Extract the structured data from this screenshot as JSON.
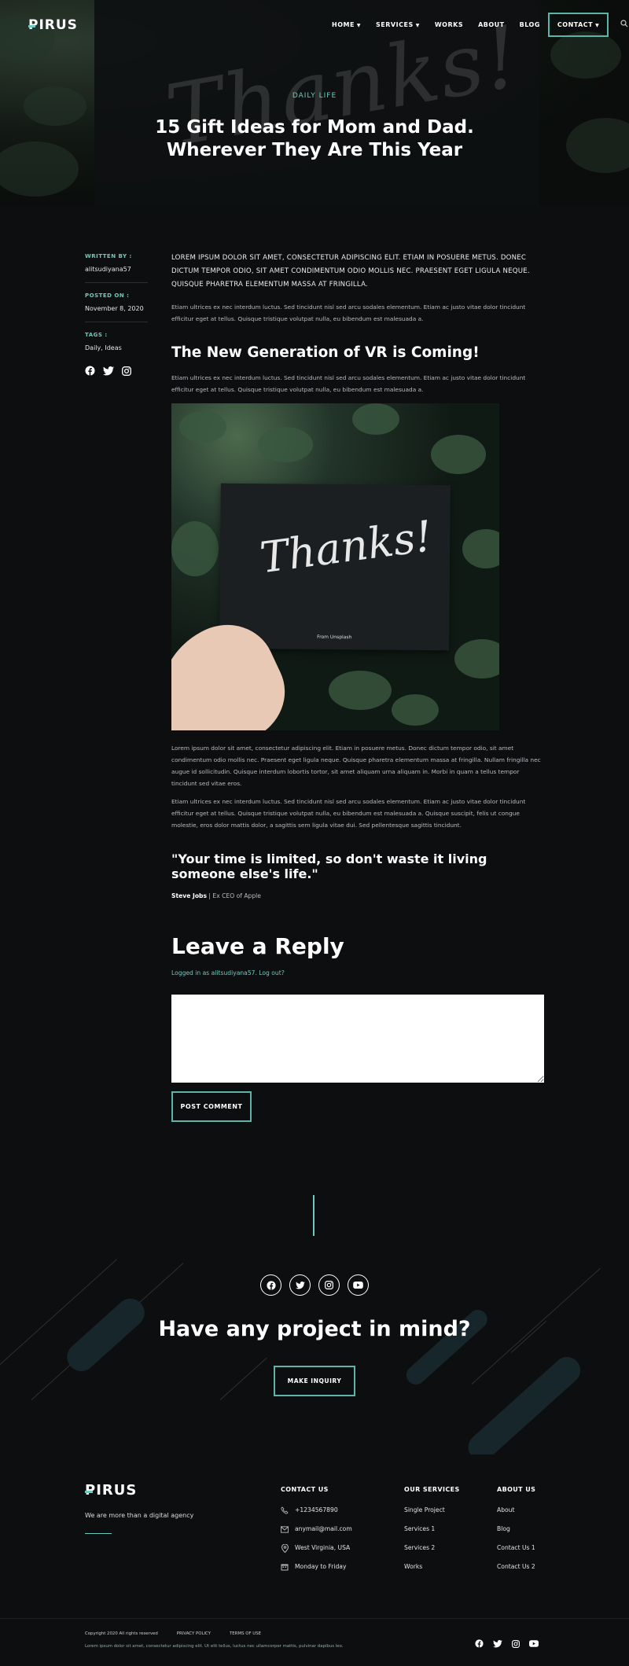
{
  "brand": {
    "logo": "PIRUS",
    "accent": "#6fc9bd"
  },
  "nav": {
    "items": [
      {
        "label": "HOME",
        "has_dropdown": true
      },
      {
        "label": "SERVICES",
        "has_dropdown": true
      },
      {
        "label": "WORKS",
        "has_dropdown": false
      },
      {
        "label": "ABOUT",
        "has_dropdown": false
      },
      {
        "label": "BLOG",
        "has_dropdown": false
      }
    ],
    "contact_label": "CONTACT",
    "search_icon": "search-icon"
  },
  "hero": {
    "background_text": "Thanks!",
    "category": "DAILY LIFE",
    "title": "15 Gift Ideas for Mom and Dad. Wherever They Are This Year"
  },
  "meta": {
    "written_by_label": "WRITTEN BY :",
    "author": "alitsudiyana57",
    "posted_on_label": "POSTED ON :",
    "date": "November 8, 2020",
    "tags_label": "TAGS :",
    "tags": "Daily, Ideas",
    "social_icons": [
      "facebook-icon",
      "twitter-icon",
      "instagram-icon"
    ]
  },
  "article": {
    "lead": "LOREM IPSUM DOLOR SIT AMET, CONSECTETUR ADIPISCING ELIT. ETIAM IN POSUERE METUS. DONEC DICTUM TEMPOR ODIO, SIT AMET CONDIMENTUM ODIO MOLLIS NEC. PRAESENT EGET LIGULA NEQUE. QUISQUE PHARETRA ELEMENTUM MASSA AT FRINGILLA.",
    "p1": "Etiam ultrices ex nec interdum luctus. Sed tincidunt nisl sed arcu sodales elementum. Etiam ac justo vitae dolor tincidunt efficitur eget at tellus. Quisque tristique volutpat nulla, eu bibendum est malesuada a.",
    "heading": "The New Generation of VR is Coming!",
    "p2": "Etiam ultrices ex nec interdum luctus. Sed tincidunt nisl sed arcu sodales elementum. Etiam ac justo vitae dolor tincidunt efficitur eget at tellus. Quisque tristique volutpat nulla, eu bibendum est malesuada a.",
    "image_card_text": "Thanks!",
    "image_card_caption": "From Unsplash",
    "p3": "Lorem ipsum dolor sit amet, consectetur adipiscing elit. Etiam in posuere metus. Donec dictum tempor odio, sit amet condimentum odio mollis nec. Praesent eget ligula neque. Quisque pharetra elementum massa at fringilla. Nullam fringilla nec augue id sollicitudin. Quisque interdum lobortis tortor, sit amet aliquam urna aliquam in. Morbi in quam a tellus tempor tincidunt sed vitae eros.",
    "p4": "Etiam ultrices ex nec interdum luctus. Sed tincidunt nisl sed arcu sodales elementum. Etiam ac justo vitae dolor tincidunt efficitur eget at tellus. Quisque tristique volutpat nulla, eu bibendum est malesuada a. Quisque suscipit, felis ut congue molestie, eros dolor mattis dolor, a sagittis sem ligula vitae dui. Sed pellentesque sagittis tincidunt.",
    "quote": "\"Your time is limited, so don't waste it living someone else's life.\"",
    "quote_author": "Steve Jobs",
    "quote_role": "| Ex CEO of Apple"
  },
  "reply": {
    "heading": "Leave a Reply",
    "logged_in": "Logged in as alitsudiyana57. Log out?",
    "comment_value": "",
    "post_label": "POST COMMENT"
  },
  "cta": {
    "social_icons": [
      "facebook-icon",
      "twitter-icon",
      "instagram-icon",
      "youtube-icon"
    ],
    "heading": "Have any project in mind?",
    "button": "MAKE INQUIRY"
  },
  "footer": {
    "tagline": "We are more than a digital agency",
    "contact": {
      "heading": "CONTACT US",
      "items": [
        {
          "icon": "phone-icon",
          "text": "+1234567890"
        },
        {
          "icon": "mail-icon",
          "text": "anymail@mail.com"
        },
        {
          "icon": "location-icon",
          "text": "West Virginia, USA"
        },
        {
          "icon": "calendar-icon",
          "text": "Monday to Friday"
        }
      ]
    },
    "services": {
      "heading": "OUR SERVICES",
      "items": [
        "Single Project",
        "Services 1",
        "Services 2",
        "Works"
      ]
    },
    "about": {
      "heading": "ABOUT US",
      "items": [
        "About",
        "Blog",
        "Contact Us 1",
        "Contact Us 2"
      ]
    },
    "copyright": "Copyright 2020 All rights reserved",
    "privacy": "PRIVACY POLICY",
    "terms": "TERMS OF USE",
    "bottom_text": "Lorem ipsum dolor sit amet, consectetur adipiscing elit. Ut elit tellus, luctus nec ullamcorper mattis, pulvinar dapibus leo.",
    "social_icons": [
      "facebook-icon",
      "twitter-icon",
      "instagram-icon",
      "youtube-icon"
    ]
  }
}
